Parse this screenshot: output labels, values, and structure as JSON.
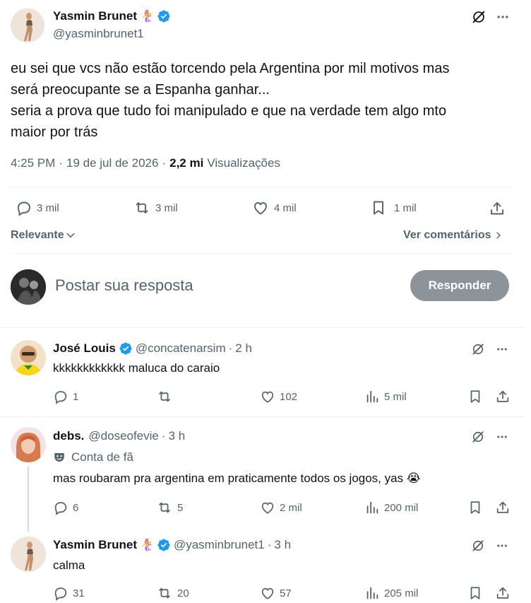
{
  "main_post": {
    "author_name": "Yasmin Brunet",
    "author_emoji": "🧜‍♀️",
    "author_handle": "@yasminbrunet1",
    "text_lines": [
      "eu sei que vcs não estão torcendo pela Argentina por mil motivos mas",
      "será preocupante se a Espanha ganhar...",
      "seria a prova que tudo foi manipulado e que na verdade tem algo mto",
      "maior por trás"
    ],
    "time": "4:25 PM",
    "date": "19 de jul de 2026",
    "views_count": "2,2 mi",
    "views_label": "Visualizações",
    "replies": "3 mil",
    "reposts": "3 mil",
    "likes": "4 mil",
    "bookmarks": "1 mil"
  },
  "sort": {
    "label": "Relevante",
    "see_comments": "Ver comentários"
  },
  "composer": {
    "placeholder": "Postar sua resposta",
    "button": "Responder"
  },
  "replies": [
    {
      "name": "José Louis",
      "handle": "@concatenarsim",
      "time": "2 h",
      "text": "kkkkkkkkkkkk maluca do caraio",
      "replies": "1",
      "reposts": "",
      "likes": "102",
      "views": "5 mil"
    },
    {
      "name": "debs.",
      "handle": "@doseofevie",
      "time": "3 h",
      "badge": "Conta de fã",
      "text": "mas roubaram pra argentina em praticamente todos os jogos, yas 😭",
      "replies": "6",
      "reposts": "5",
      "likes": "2 mil",
      "views": "200 mil"
    },
    {
      "name": "Yasmin Brunet",
      "emoji": "🧜‍♀️",
      "handle": "@yasminbrunet1",
      "time": "3 h",
      "text": "calma",
      "replies": "31",
      "reposts": "20",
      "likes": "57",
      "views": "205 mil"
    }
  ],
  "colors": {
    "text": "#0f1419",
    "muted": "#536471",
    "verified": "#1d9bf0",
    "divider": "#eff3f4",
    "button_disabled": "#8c9399"
  }
}
